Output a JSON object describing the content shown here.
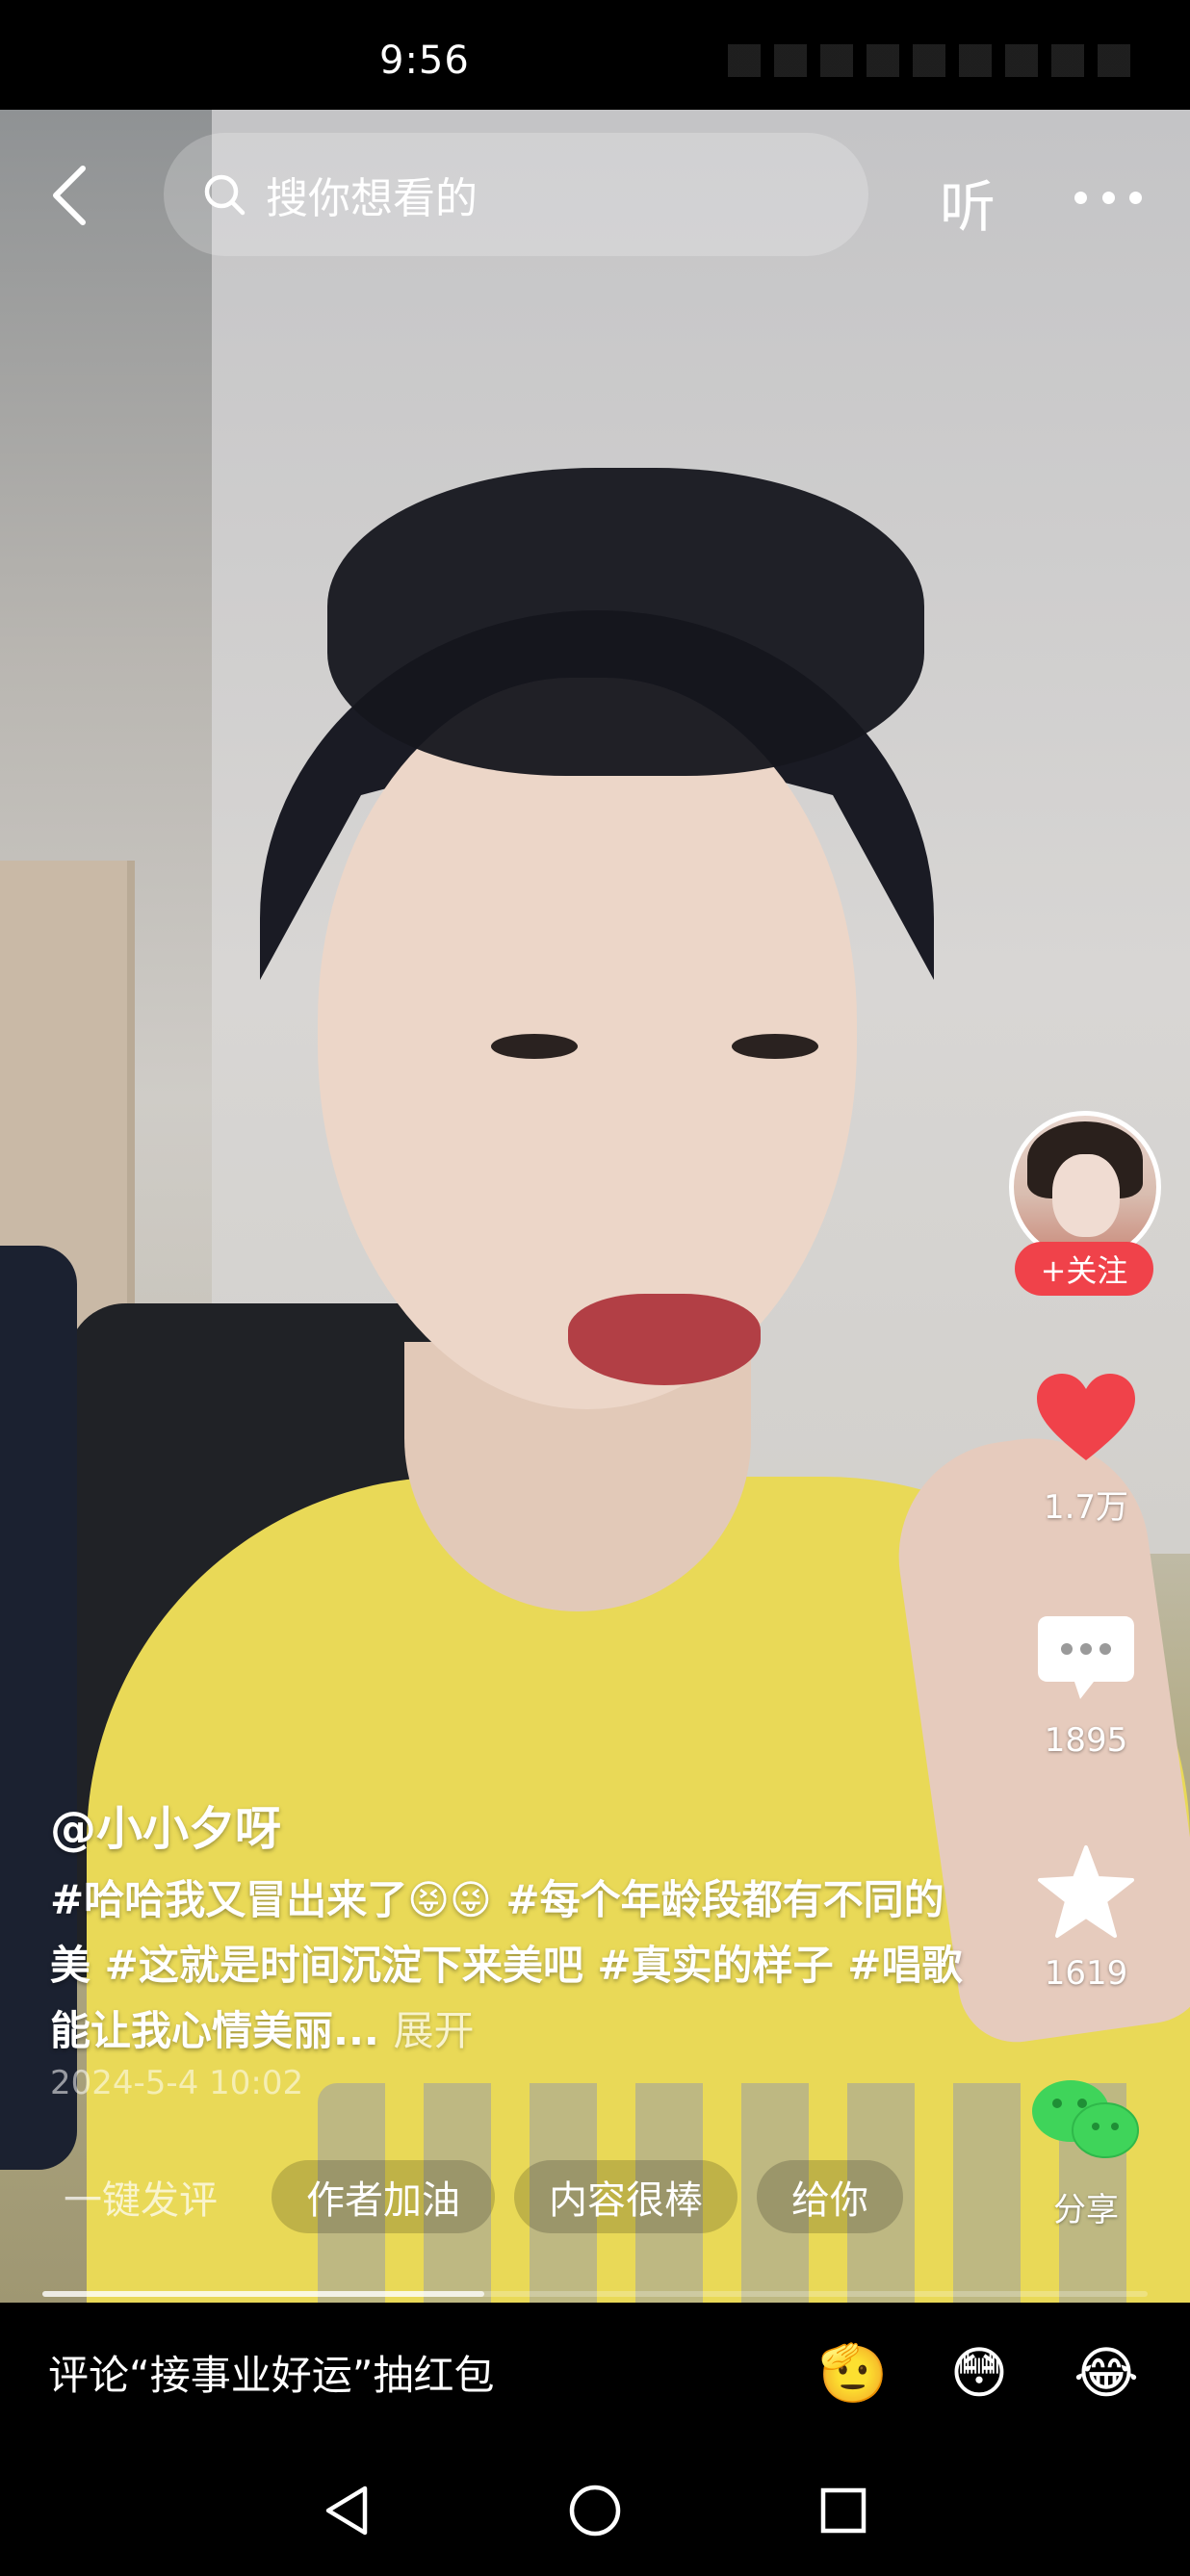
{
  "status_bar": {
    "time": "9:56"
  },
  "search": {
    "placeholder": "搜你想看的"
  },
  "top_bar": {
    "listen_label": "听"
  },
  "author": {
    "name": "@小小夕呀",
    "follow_label": "+关注"
  },
  "actions": {
    "likes": "1.7万",
    "comments": "1895",
    "favorites": "1619",
    "share_label": "分享"
  },
  "caption": {
    "text": "#哈哈我又冒出来了😝😜 #每个年龄段都有不同的美 #这就是时间沉淀下来美吧 #真实的样子 #唱歌能让我心情美丽...",
    "expand": "展开"
  },
  "post_date": "2024-5-4 10:02",
  "quick_comments": [
    "一键发评",
    "作者加油",
    "内容很棒",
    "给你"
  ],
  "playback_progress": 0.4,
  "comment_bar": {
    "prompt": "评论“接事业好运”抽红包",
    "emojis": [
      "🫡",
      "😳",
      "😂"
    ]
  },
  "colors": {
    "accent": "#f0424a",
    "like": "#f0424a",
    "share": "#3fd45a"
  }
}
